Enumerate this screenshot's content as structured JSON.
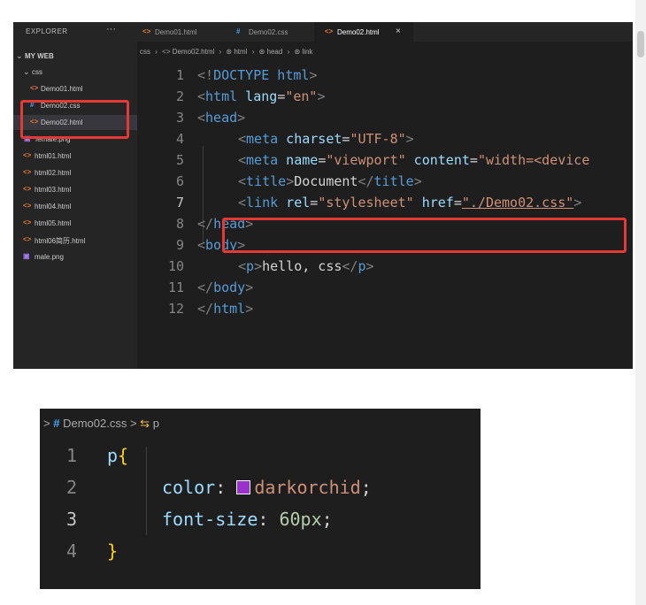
{
  "explorer": {
    "title": "EXPLORER",
    "more": "···",
    "root_folder": "MY WEB",
    "css_folder": "css",
    "items": [
      {
        "icon": "<>",
        "type": "html",
        "label": "Demo01.html"
      },
      {
        "icon": "#",
        "type": "css",
        "label": "Demo02.css"
      },
      {
        "icon": "<>",
        "type": "html",
        "label": "Demo02.html"
      },
      {
        "icon": "▣",
        "type": "img",
        "label": "female.png"
      },
      {
        "icon": "<>",
        "type": "html",
        "label": "html01.html"
      },
      {
        "icon": "<>",
        "type": "html",
        "label": "html02.html"
      },
      {
        "icon": "<>",
        "type": "html",
        "label": "html03.html"
      },
      {
        "icon": "<>",
        "type": "html",
        "label": "html04.html"
      },
      {
        "icon": "<>",
        "type": "html",
        "label": "html05.html"
      },
      {
        "icon": "<>",
        "type": "html",
        "label": "html06简历.html"
      },
      {
        "icon": "▣",
        "type": "img",
        "label": "male.png"
      }
    ]
  },
  "tabs": [
    {
      "icon": "<>",
      "label": "Demo01.html"
    },
    {
      "icon": "#",
      "label": "Demo02.css"
    },
    {
      "icon": "<>",
      "label": "Demo02.html",
      "close": "×"
    }
  ],
  "breadcrumb1": [
    "css",
    "›",
    "<> Demo02.html",
    "›",
    "⊛ html",
    "›",
    "⊛ head",
    "›",
    "⊛ link"
  ],
  "code1": {
    "line_numbers": [
      "1",
      "2",
      "3",
      "4",
      "5",
      "6",
      "7",
      "8",
      "9",
      "10",
      "11",
      "12"
    ],
    "l1": [
      "<!",
      "DOCTYPE",
      " html",
      ">"
    ],
    "l2": [
      "<",
      "html",
      " lang",
      "=",
      "\"en\"",
      ">"
    ],
    "l3": [
      "<",
      "head",
      ">"
    ],
    "l4": [
      "<",
      "meta",
      " charset",
      "=",
      "\"UTF-8\"",
      ">"
    ],
    "l5": [
      "<",
      "meta",
      " name",
      "=",
      "\"viewport\"",
      " content",
      "=",
      "\"width=<device"
    ],
    "l6": [
      "<",
      "title",
      ">",
      "Document",
      "</",
      "title",
      ">"
    ],
    "l7": [
      "<",
      "link",
      " rel",
      "=",
      "\"stylesheet\"",
      " href",
      "=",
      "\"./Demo02.css\"",
      ">"
    ],
    "l8": [
      "</",
      "head",
      ">"
    ],
    "l9": [
      "<",
      "body",
      ">"
    ],
    "l10": [
      "<",
      "p",
      ">",
      "hello, css",
      "</",
      "p",
      ">"
    ],
    "l11": [
      "</",
      "body",
      ">"
    ],
    "l12": [
      "</",
      "html",
      ">"
    ]
  },
  "breadcrumb2": {
    "sep1": ">",
    "hash": "#",
    "file": "Demo02.css",
    "sep2": ">",
    "sym": "⇆",
    "symbol": "p"
  },
  "code2": {
    "line_numbers": [
      "1",
      "2",
      "3",
      "4"
    ],
    "l1_sel": "p",
    "l1_brace": "{",
    "l2_prop": "color",
    "l2_colon": ": ",
    "l2_val": "darkorchid",
    "l2_semi": ";",
    "l3_prop": "font-size",
    "l3_colon": ": ",
    "l3_val": "60px",
    "l3_semi": ";",
    "l4_brace": "}"
  },
  "colors": {
    "swatch": "#9932cc",
    "highlight": "#e53935"
  }
}
